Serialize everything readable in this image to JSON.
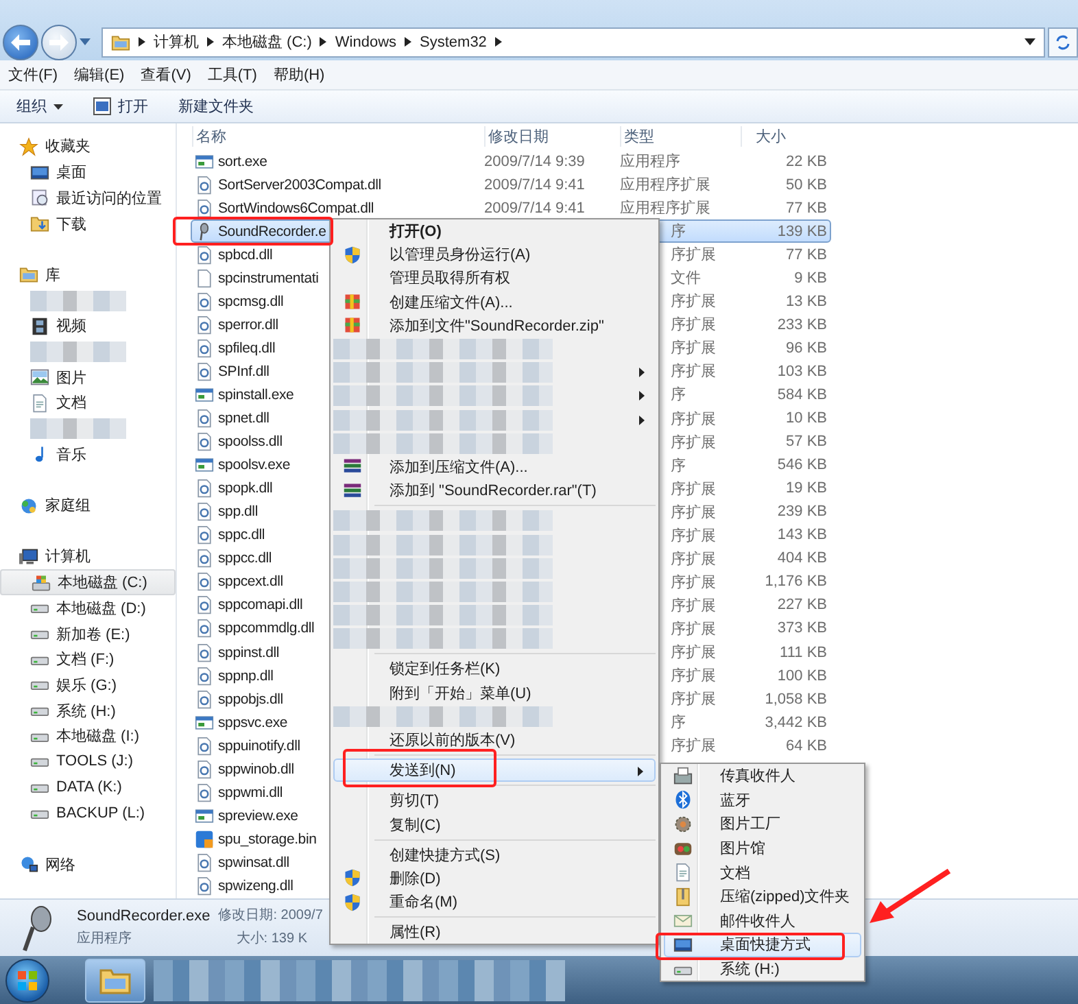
{
  "address_bar": {
    "path": [
      "计算机",
      "本地磁盘 (C:)",
      "Windows",
      "System32"
    ]
  },
  "menu_bar": [
    "文件(F)",
    "编辑(E)",
    "查看(V)",
    "工具(T)",
    "帮助(H)"
  ],
  "toolbar": [
    {
      "label": "组织",
      "kind": "dropdown"
    },
    {
      "label": "打开",
      "kind": "icon"
    },
    {
      "label": "新建文件夹",
      "kind": "plain"
    }
  ],
  "sidebar": {
    "groups": [
      {
        "label": "收藏夹",
        "kind": "star",
        "items": [
          {
            "kind": "desktop",
            "label": "桌面",
            "selected": false
          },
          {
            "kind": "recent",
            "label": "最近访问的位置",
            "selected": false
          },
          {
            "kind": "download",
            "label": "下载",
            "selected": false
          }
        ]
      },
      {
        "label": "库",
        "kind": "library",
        "items": [
          {
            "kind": "blurred"
          },
          {
            "kind": "video",
            "label": "视频",
            "selected": false
          },
          {
            "kind": "blurred"
          },
          {
            "kind": "picture",
            "label": "图片",
            "selected": false
          },
          {
            "kind": "doc",
            "label": "文档",
            "selected": false
          },
          {
            "kind": "blurred"
          },
          {
            "kind": "music",
            "label": "音乐",
            "selected": false
          }
        ]
      },
      {
        "label": "家庭组",
        "kind": "homegroup"
      },
      {
        "label": "计算机",
        "kind": "computer",
        "items": [
          {
            "kind": "windrive",
            "label": "本地磁盘 (C:)",
            "selected": true
          },
          {
            "kind": "drive",
            "label": "本地磁盘 (D:)",
            "selected": false
          },
          {
            "kind": "drive",
            "label": "新加卷 (E:)",
            "selected": false
          },
          {
            "kind": "drive",
            "label": "文档 (F:)",
            "selected": false
          },
          {
            "kind": "drive",
            "label": "娱乐 (G:)",
            "selected": false
          },
          {
            "kind": "drive",
            "label": "系统 (H:)",
            "selected": false
          },
          {
            "kind": "drive",
            "label": "本地磁盘 (I:)",
            "selected": false
          },
          {
            "kind": "drive",
            "label": "TOOLS (J:)",
            "selected": false
          },
          {
            "kind": "drive",
            "label": "DATA (K:)",
            "selected": false
          },
          {
            "kind": "drive",
            "label": "BACKUP (L:)",
            "selected": false
          }
        ]
      },
      {
        "label": "网络",
        "kind": "network"
      }
    ]
  },
  "files": {
    "columns": [
      "名称",
      "修改日期",
      "类型",
      "大小"
    ],
    "rows": [
      {
        "name": "sort.exe",
        "date": "2009/7/14 9:39",
        "type": "应用程序",
        "size": "22 KB",
        "kind": "exe",
        "selected": false
      },
      {
        "name": "SortServer2003Compat.dll",
        "date": "2009/7/14 9:41",
        "type": "应用程序扩展",
        "size": "50 KB",
        "kind": "dll",
        "selected": false
      },
      {
        "name": "SortWindows6Compat.dll",
        "date": "2009/7/14 9:41",
        "type": "应用程序扩展",
        "size": "77 KB",
        "kind": "dll",
        "selected": false
      },
      {
        "name": "SoundRecorder.e",
        "type": "序",
        "size": "139 KB",
        "kind": "mic",
        "selected": true
      },
      {
        "name": "spbcd.dll",
        "type": "序扩展",
        "size": "77 KB",
        "kind": "dll",
        "selected": false
      },
      {
        "name": "spcinstrumentati",
        "type": "文件",
        "size": "9 KB",
        "kind": "blank",
        "selected": false
      },
      {
        "name": "spcmsg.dll",
        "type": "序扩展",
        "size": "13 KB",
        "kind": "dll",
        "selected": false
      },
      {
        "name": "sperror.dll",
        "type": "序扩展",
        "size": "233 KB",
        "kind": "dll",
        "selected": false
      },
      {
        "name": "spfileq.dll",
        "type": "序扩展",
        "size": "96 KB",
        "kind": "dll",
        "selected": false
      },
      {
        "name": "SPInf.dll",
        "type": "序扩展",
        "size": "103 KB",
        "kind": "dll",
        "selected": false
      },
      {
        "name": "spinstall.exe",
        "type": "序",
        "size": "584 KB",
        "kind": "exe",
        "selected": false
      },
      {
        "name": "spnet.dll",
        "type": "序扩展",
        "size": "10 KB",
        "kind": "dll",
        "selected": false
      },
      {
        "name": "spoolss.dll",
        "type": "序扩展",
        "size": "57 KB",
        "kind": "dll",
        "selected": false
      },
      {
        "name": "spoolsv.exe",
        "type": "序",
        "size": "546 KB",
        "kind": "exe",
        "selected": false
      },
      {
        "name": "spopk.dll",
        "type": "序扩展",
        "size": "19 KB",
        "kind": "dll",
        "selected": false
      },
      {
        "name": "spp.dll",
        "type": "序扩展",
        "size": "239 KB",
        "kind": "dll",
        "selected": false
      },
      {
        "name": "sppc.dll",
        "type": "序扩展",
        "size": "143 KB",
        "kind": "dll",
        "selected": false
      },
      {
        "name": "sppcc.dll",
        "type": "序扩展",
        "size": "404 KB",
        "kind": "dll",
        "selected": false
      },
      {
        "name": "sppcext.dll",
        "type": "序扩展",
        "size": "1,176 KB",
        "kind": "dll",
        "selected": false
      },
      {
        "name": "sppcomapi.dll",
        "type": "序扩展",
        "size": "227 KB",
        "kind": "dll",
        "selected": false
      },
      {
        "name": "sppcommdlg.dll",
        "type": "序扩展",
        "size": "373 KB",
        "kind": "dll",
        "selected": false
      },
      {
        "name": "sppinst.dll",
        "type": "序扩展",
        "size": "111 KB",
        "kind": "dll",
        "selected": false
      },
      {
        "name": "sppnp.dll",
        "type": "序扩展",
        "size": "100 KB",
        "kind": "dll",
        "selected": false
      },
      {
        "name": "sppobjs.dll",
        "type": "序扩展",
        "size": "1,058 KB",
        "kind": "dll",
        "selected": false
      },
      {
        "name": "sppsvc.exe",
        "type": "序",
        "size": "3,442 KB",
        "kind": "exe",
        "selected": false
      },
      {
        "name": "sppuinotify.dll",
        "type": "序扩展",
        "size": "64 KB",
        "kind": "dll",
        "selected": false
      },
      {
        "name": "sppwinob.dll",
        "kind": "dll",
        "selected": false
      },
      {
        "name": "sppwmi.dll",
        "kind": "dll",
        "selected": false
      },
      {
        "name": "spreview.exe",
        "kind": "exe",
        "selected": false
      },
      {
        "name": "spu_storage.bin",
        "kind": "bin",
        "selected": false
      },
      {
        "name": "spwinsat.dll",
        "kind": "dll",
        "selected": false
      },
      {
        "name": "spwizeng.dll",
        "kind": "dll",
        "selected": false
      }
    ]
  },
  "details_pane": {
    "name": "SoundRecorder.exe",
    "modified": "修改日期: 2009/7",
    "type": "应用程序",
    "size": "大小: 139 K"
  },
  "context_menu": {
    "items": [
      {
        "kind": "default",
        "label": "打开(O)",
        "submenu": false,
        "selected": false
      },
      {
        "kind": "shield",
        "label": "以管理员身份运行(A)",
        "submenu": false,
        "selected": false
      },
      {
        "kind": "plain",
        "label": "管理员取得所有权",
        "submenu": false,
        "selected": false
      },
      {
        "kind": "zip",
        "label": "创建压缩文件(A)...",
        "submenu": false,
        "selected": false
      },
      {
        "kind": "zip",
        "label": "添加到文件\"SoundRecorder.zip\"",
        "submenu": false,
        "selected": false
      },
      {
        "kind": "blurred",
        "submenu": false
      },
      {
        "kind": "blurred",
        "submenu": true
      },
      {
        "kind": "blurred",
        "submenu": true
      },
      {
        "kind": "blurred",
        "submenu": true
      },
      {
        "kind": "blurred",
        "submenu": false
      },
      {
        "kind": "rar",
        "label": "添加到压缩文件(A)...",
        "submenu": false,
        "selected": false
      },
      {
        "kind": "rar",
        "label": "添加到 \"SoundRecorder.rar\"(T)",
        "submenu": false,
        "selected": false
      },
      {
        "kind": "separator"
      },
      {
        "kind": "blurred",
        "submenu": false
      },
      {
        "kind": "blurred",
        "submenu": false
      },
      {
        "kind": "blurred",
        "submenu": false
      },
      {
        "kind": "blurred",
        "submenu": false
      },
      {
        "kind": "blurred",
        "submenu": false
      },
      {
        "kind": "blurred",
        "submenu": false
      },
      {
        "kind": "separator"
      },
      {
        "kind": "plain",
        "label": "锁定到任务栏(K)",
        "submenu": false,
        "selected": false
      },
      {
        "kind": "plain",
        "label": "附到「开始」菜单(U)",
        "submenu": false,
        "selected": false
      },
      {
        "kind": "blurred",
        "submenu": false
      },
      {
        "kind": "plain",
        "label": "还原以前的版本(V)",
        "submenu": false,
        "selected": false
      },
      {
        "kind": "separator"
      },
      {
        "kind": "plain",
        "label": "发送到(N)",
        "submenu": true,
        "selected": true
      },
      {
        "kind": "separator"
      },
      {
        "kind": "plain",
        "label": "剪切(T)",
        "submenu": false,
        "selected": false
      },
      {
        "kind": "plain",
        "label": "复制(C)",
        "submenu": false,
        "selected": false
      },
      {
        "kind": "separator"
      },
      {
        "kind": "plain",
        "label": "创建快捷方式(S)",
        "submenu": false,
        "selected": false
      },
      {
        "kind": "shield",
        "label": "删除(D)",
        "submenu": false,
        "selected": false
      },
      {
        "kind": "shield",
        "label": "重命名(M)",
        "submenu": false,
        "selected": false
      },
      {
        "kind": "separator"
      },
      {
        "kind": "plain",
        "label": "属性(R)",
        "submenu": false,
        "selected": false
      }
    ]
  },
  "send_to_menu": {
    "items": [
      {
        "label": "传真收件人",
        "kind": "fax",
        "selected": false
      },
      {
        "label": "蓝牙",
        "kind": "bluetooth",
        "selected": false
      },
      {
        "label": "图片工厂",
        "kind": "gear",
        "selected": false
      },
      {
        "label": "图片馆",
        "kind": "gallery",
        "selected": false
      },
      {
        "label": "文档",
        "kind": "doc",
        "selected": false
      },
      {
        "label": "压缩(zipped)文件夹",
        "kind": "zipfolder",
        "selected": false
      },
      {
        "label": "邮件收件人",
        "kind": "mail",
        "selected": false
      },
      {
        "label": "桌面快捷方式",
        "kind": "desktop",
        "selected": true
      },
      {
        "label": "系统 (H:)",
        "kind": "drive",
        "selected": false
      }
    ]
  }
}
